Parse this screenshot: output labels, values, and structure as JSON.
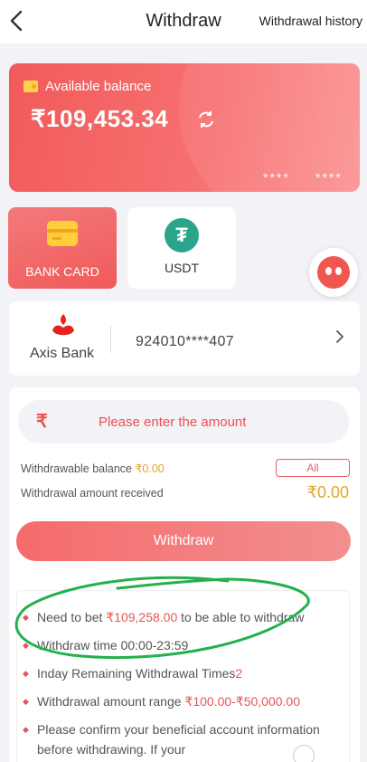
{
  "header": {
    "title": "Withdraw",
    "history_link": "Withdrawal history",
    "back_glyph": "‹"
  },
  "balance_card": {
    "label": "Available balance",
    "amount": "₹109,453.34",
    "masked_left": "****",
    "masked_right": "****",
    "refresh_icon": "refresh-icon"
  },
  "methods": [
    {
      "label": "BANK CARD",
      "icon": "bank-card-icon",
      "selected": true
    },
    {
      "label": "USDT",
      "icon": "tether-icon",
      "selected": false
    }
  ],
  "bank": {
    "name": "Axis Bank",
    "account": "924010****407",
    "chevron": "›"
  },
  "form": {
    "amount_placeholder": "Please enter the amount",
    "withdrawable_label": "Withdrawable balance ",
    "withdrawable_value": "₹0.00",
    "all_button": "All",
    "received_label": "Withdrawal amount received",
    "received_value": "₹0.00",
    "withdraw_button": "Withdraw"
  },
  "notes": {
    "n1_pre": "Need to bet ",
    "n1_amount": "₹109,258.00",
    "n1_post": " to be able to withdraw",
    "n2_pre": "Withdraw time ",
    "n2_time": "00:00-23:59",
    "n3_pre": "Inday Remaining Withdrawal Times",
    "n3_count": "2",
    "n4_pre": "Withdrawal amount range ",
    "n4_range": "₹100.00-₹50,000.00",
    "n5": "Please confirm your beneficial account information before withdrawing. If your"
  },
  "colors": {
    "accent": "#f25a5a",
    "gold": "#e0a72b",
    "annotation": "#22b14c"
  }
}
